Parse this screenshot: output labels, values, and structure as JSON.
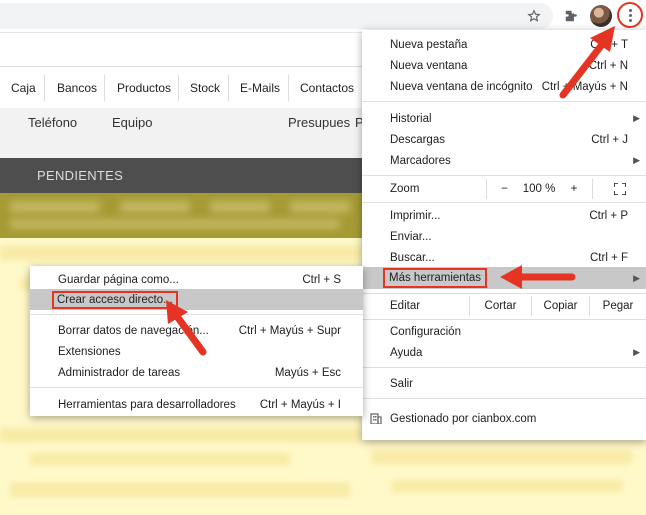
{
  "browser": {
    "icons": {
      "star": "star-icon",
      "extensions": "puzzle-icon",
      "avatar": "profile-avatar",
      "menu": "kebab-menu-icon"
    }
  },
  "page": {
    "nav": [
      "Caja",
      "Bancos",
      "Productos",
      "Stock",
      "E-Mails",
      "Contactos"
    ],
    "subnav": [
      "Teléfono",
      "Equipo",
      "Presupues",
      "P"
    ],
    "section_title": "PENDIENTES"
  },
  "main_menu": {
    "new_tab": "Nueva pestaña",
    "new_tab_sc": "Ctrl + T",
    "new_window": "Nueva ventana",
    "new_window_sc": "Ctrl + N",
    "incognito": "Nueva ventana de incógnito",
    "incognito_sc": "Ctrl + Mayús + N",
    "history": "Historial",
    "downloads": "Descargas",
    "downloads_sc": "Ctrl + J",
    "bookmarks": "Marcadores",
    "zoom": "Zoom",
    "zoom_minus": "−",
    "zoom_value": "100 %",
    "zoom_plus": "+",
    "print": "Imprimir...",
    "print_sc": "Ctrl + P",
    "send": "Enviar...",
    "find": "Buscar...",
    "find_sc": "Ctrl + F",
    "more_tools": "Más herramientas",
    "edit": "Editar",
    "cut": "Cortar",
    "copy": "Copiar",
    "paste": "Pegar",
    "settings": "Configuración",
    "help": "Ayuda",
    "exit": "Salir",
    "managed": "Gestionado por cianbox.com"
  },
  "sub_menu": {
    "save_page": "Guardar página como...",
    "save_page_sc": "Ctrl + S",
    "create_shortcut": "Crear acceso directo...",
    "clear_data": "Borrar datos de navegación...",
    "clear_data_sc": "Ctrl + Mayús + Supr",
    "extensions": "Extensiones",
    "task_manager": "Administrador de tareas",
    "task_manager_sc": "Mayús + Esc",
    "dev_tools": "Herramientas para desarrolladores",
    "dev_tools_sc": "Ctrl + Mayús + I"
  },
  "colors": {
    "annotation": "#e53423",
    "hover": "#c8c8c8"
  }
}
